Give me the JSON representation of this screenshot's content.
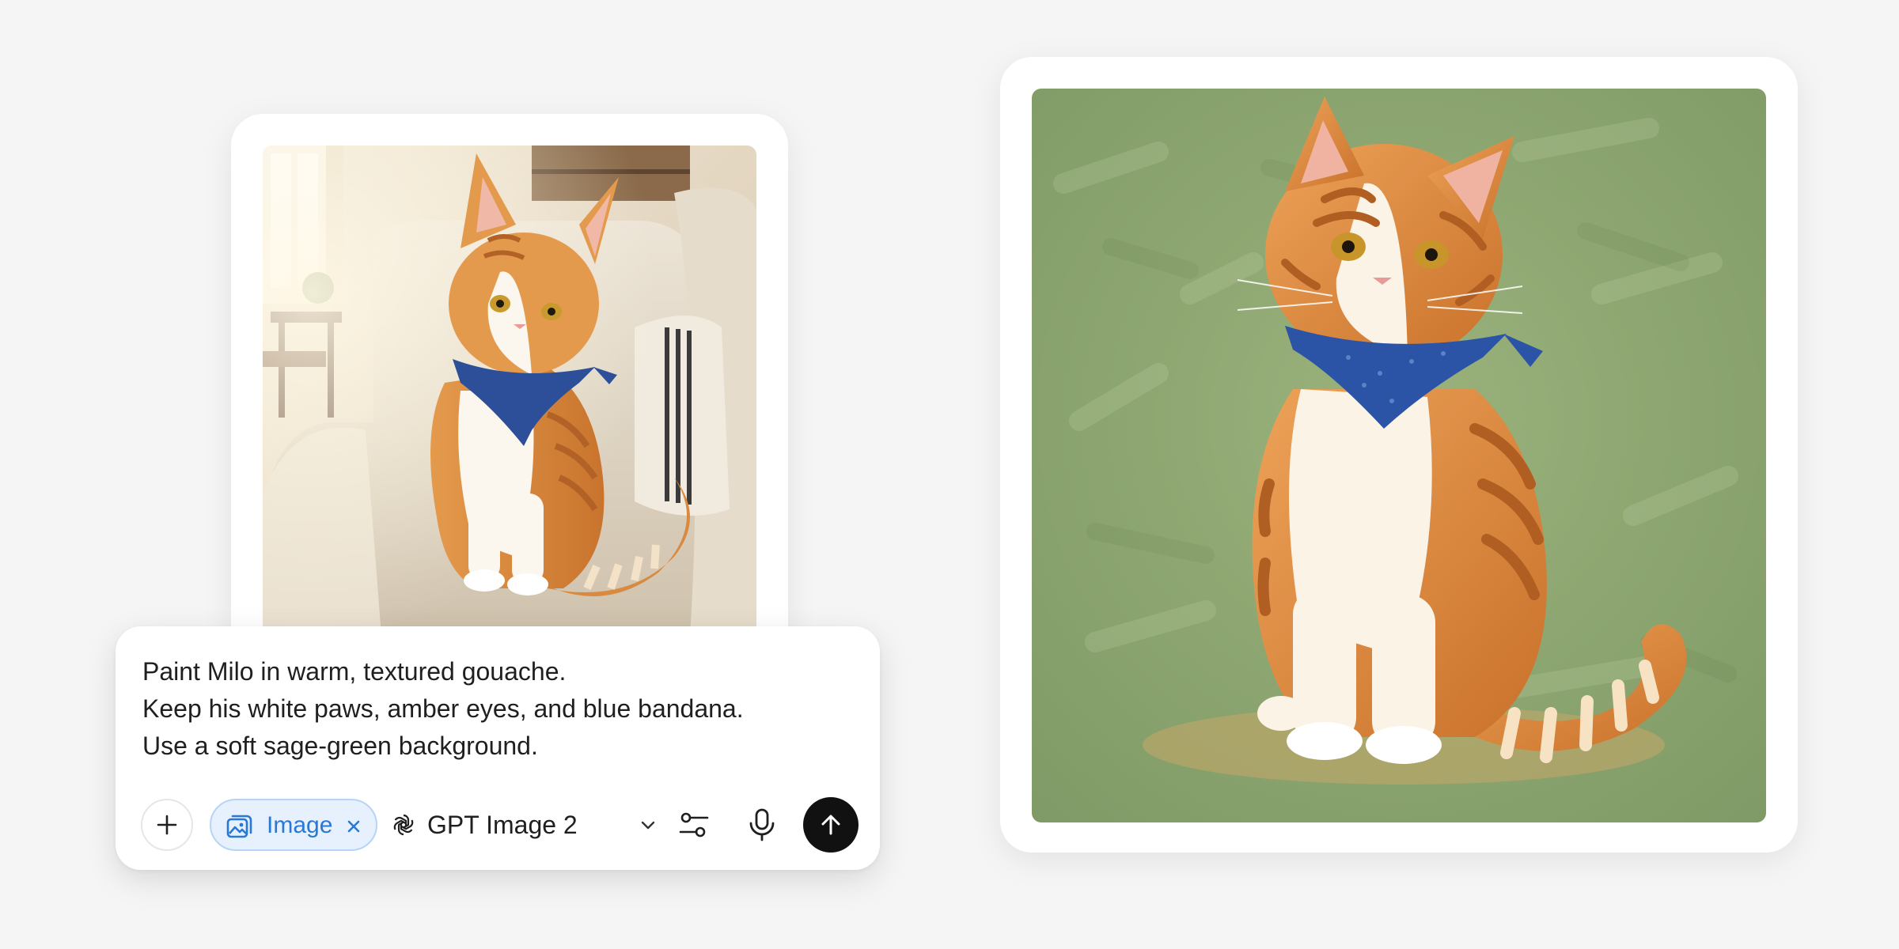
{
  "reference_photo": {
    "subject": "orange tabby cat on armchair",
    "icon": "photo"
  },
  "composer": {
    "prompt_lines": [
      "Paint Milo in warm, textured gouache.",
      "Keep his white paws, amber eyes, and blue bandana.",
      "Use a soft sage-green background."
    ],
    "add_icon": "plus-icon",
    "image_chip": {
      "label": "Image",
      "icon": "image-icon",
      "remove_icon": "close-icon",
      "color": "#2a78d6"
    },
    "model": {
      "label": "GPT Image 2",
      "icon": "openai-logo-icon",
      "dropdown_icon": "chevron-down-icon"
    },
    "settings_icon": "sliders-icon",
    "mic_icon": "microphone-icon",
    "send_icon": "arrow-up-icon"
  },
  "result_image": {
    "subject": "gouache painting of orange tabby cat with blue bandana on sage-green background",
    "background_color": "#8fa872"
  }
}
